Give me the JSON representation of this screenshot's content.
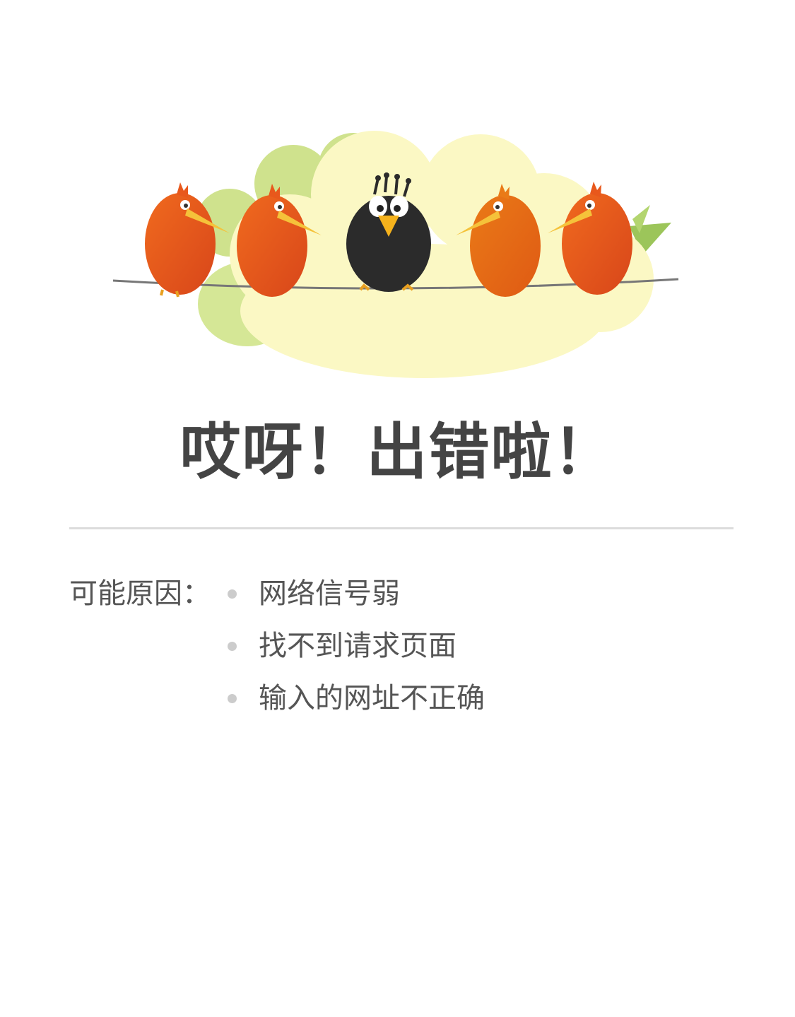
{
  "error": {
    "title": "哎呀！出错啦！"
  },
  "reasons": {
    "label": "可能原因：",
    "items": [
      "网络信号弱",
      "找不到请求页面",
      "输入的网址不正确"
    ]
  },
  "illustration": {
    "icon": "birds-on-wire-illustration",
    "colors": {
      "cloud_yellow": "#fbf8c4",
      "cloud_green": "#cfe28d",
      "bird_orange": "#e8581c",
      "bird_black": "#2b2b2b",
      "beak": "#f5b21c"
    }
  }
}
